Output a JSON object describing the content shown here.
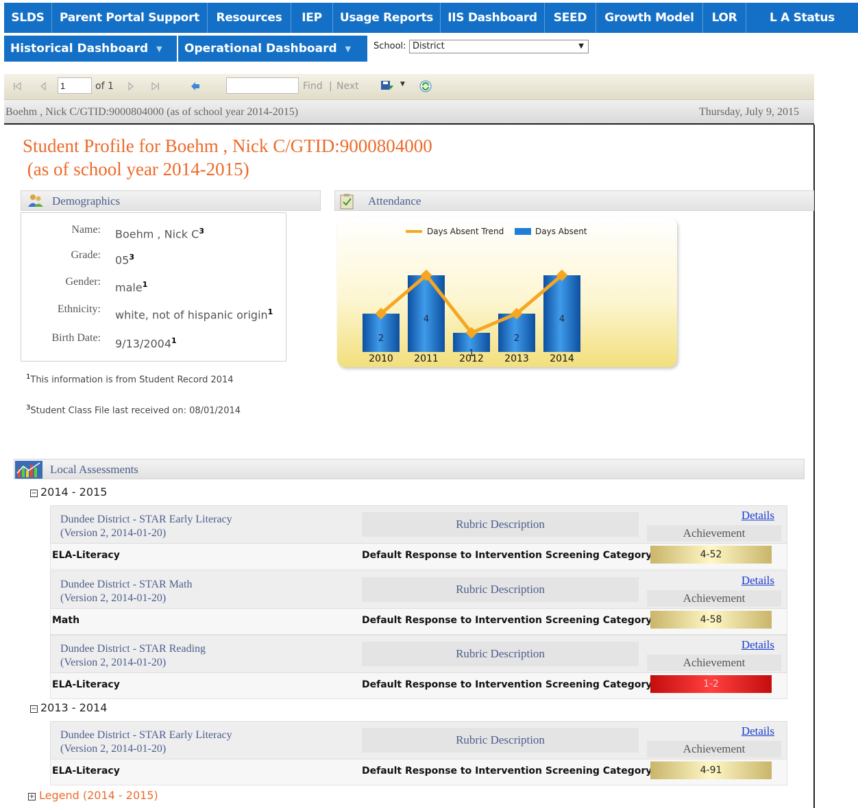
{
  "nav": {
    "row1": [
      "SLDS",
      "Parent Portal Support",
      "Resources",
      "IEP",
      "Usage Reports",
      "IIS Dashboard",
      "SEED",
      "Growth Model",
      "LOR",
      "L A Status"
    ],
    "row2": [
      "Historical Dashboard",
      "Operational Dashboard"
    ]
  },
  "school": {
    "label": "School:",
    "value": "District"
  },
  "toolbar": {
    "page": "1",
    "of_label": "of 1",
    "find": "Find",
    "separator": "|",
    "next": "Next",
    "find_value": ""
  },
  "report_header": {
    "left": "Boehm , Nick C/GTID:9000804000 (as of school year 2014-2015)",
    "right": "Thursday, July 9, 2015"
  },
  "profile": {
    "title_line1": "Student Profile for Boehm , Nick C/GTID:9000804000",
    "title_line2": " (as of school year 2014-2015)"
  },
  "demographics": {
    "title": "Demographics",
    "fields": [
      {
        "label": "Name:",
        "value": "Boehm , Nick C",
        "sup": "3"
      },
      {
        "label": "Grade:",
        "value": "05",
        "sup": "3"
      },
      {
        "label": "Gender:",
        "value": "male",
        "sup": "1"
      },
      {
        "label": "Ethnicity:",
        "value": "white, not of hispanic origin",
        "sup": "1"
      },
      {
        "label": "Birth Date:",
        "value": "9/13/2004",
        "sup": "1"
      }
    ],
    "footnotes": [
      {
        "sup": "1",
        "text": "This information is from Student Record 2014"
      },
      {
        "sup": "3",
        "text": "Student Class File last received on: 08/01/2014"
      }
    ]
  },
  "attendance": {
    "title": "Attendance"
  },
  "chart_data": {
    "type": "bar",
    "categories": [
      "2010",
      "2011",
      "2012",
      "2013",
      "2014"
    ],
    "series": [
      {
        "name": "Days Absent",
        "values": [
          2,
          4,
          1,
          2,
          4
        ],
        "color": "#1f7fd6"
      },
      {
        "name": "Days Absent Trend",
        "values": [
          2,
          4,
          1,
          2,
          4
        ],
        "color": "#f5a623"
      }
    ],
    "title": "",
    "xlabel": "",
    "ylabel": "",
    "ylim": [
      0,
      4
    ],
    "legend_placement": "top",
    "grid": false
  },
  "assessments": {
    "title": "Local Assessments",
    "rubric_label": "Rubric Description",
    "details_label": "Details",
    "achievement_label": "Achievement",
    "years": [
      {
        "label": "2014 - 2015",
        "items": [
          {
            "name": "Dundee District - STAR Early Literacy",
            "version": "(Version 2, 2014-01-20)",
            "subject": "ELA-Literacy",
            "category": "Default Response to Intervention Screening Category",
            "score": "4-52",
            "level": "gold"
          },
          {
            "name": "Dundee District - STAR Math",
            "version": "(Version 2, 2014-01-20)",
            "subject": "Math",
            "category": "Default Response to Intervention Screening Category",
            "score": "4-58",
            "level": "gold"
          },
          {
            "name": "Dundee District - STAR Reading",
            "version": "(Version 2, 2014-01-20)",
            "subject": "ELA-Literacy",
            "category": "Default Response to Intervention Screening Category",
            "score": "1-2",
            "level": "red"
          }
        ]
      },
      {
        "label": "2013 - 2014",
        "items": [
          {
            "name": "Dundee District - STAR Early Literacy",
            "version": "(Version 2, 2014-01-20)",
            "subject": "ELA-Literacy",
            "category": "Default Response to Intervention Screening Category",
            "score": "4-91",
            "level": "gold"
          }
        ]
      }
    ]
  },
  "legend_link": "Legend (2014 - 2015)",
  "colors": {
    "nav": "#1470c6",
    "title_orange": "#ec6a2a",
    "link_blue": "#1a3ccf",
    "section_text": "#4d5e8d"
  }
}
